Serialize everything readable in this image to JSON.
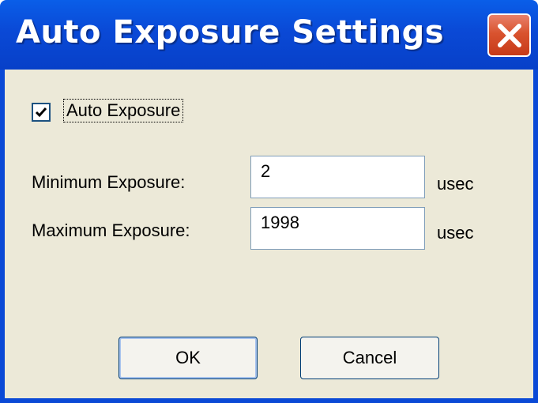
{
  "window": {
    "title": "Auto Exposure Settings"
  },
  "auto_exposure": {
    "label": "Auto Exposure",
    "checked": true
  },
  "minimum": {
    "label": "Minimum Exposure:",
    "value": "2",
    "unit": "usec"
  },
  "maximum": {
    "label": "Maximum Exposure:",
    "value": "1998",
    "unit": "usec"
  },
  "buttons": {
    "ok": "OK",
    "cancel": "Cancel"
  },
  "icons": {
    "close": "close-icon",
    "check": "checkmark-icon"
  },
  "colors": {
    "titlebar": "#0a49d6",
    "close_button": "#d9532f",
    "dialog_bg": "#ece9d8"
  }
}
